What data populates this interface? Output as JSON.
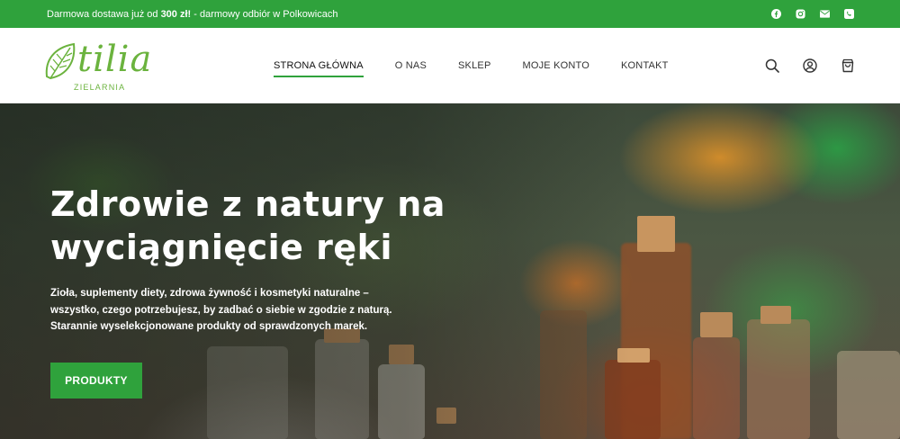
{
  "topbar": {
    "message_prefix": "Darmowa dostawa już od ",
    "message_bold": "300 zł!",
    "message_suffix": " - darmowy odbiór w Polkowicach",
    "social_icons": [
      "facebook-icon",
      "instagram-icon",
      "email-icon",
      "phone-icon"
    ]
  },
  "logo": {
    "word": "tilia",
    "subtitle": "ZIELARNIA"
  },
  "nav": {
    "items": [
      {
        "label": "STRONA GŁÓWNA",
        "active": true
      },
      {
        "label": "O NAS",
        "active": false
      },
      {
        "label": "SKLEP",
        "active": false
      },
      {
        "label": "MOJE KONTO",
        "active": false
      },
      {
        "label": "KONTAKT",
        "active": false
      }
    ]
  },
  "header_icons": [
    "search-icon",
    "account-icon",
    "cart-icon"
  ],
  "hero": {
    "title": "Zdrowie z natury na wyciągnięcie ręki",
    "description": "Zioła, suplementy diety, zdrowa żywność i kosmetyki naturalne – wszystko, czego potrzebujesz, by zadbać o siebie w zgodzie z naturą. Starannie wyselekcjonowane produkty od sprawdzonych marek.",
    "cta_label": "PRODUKTY"
  },
  "colors": {
    "brand_green": "#2fa23c",
    "logo_green": "#6bb33e"
  }
}
